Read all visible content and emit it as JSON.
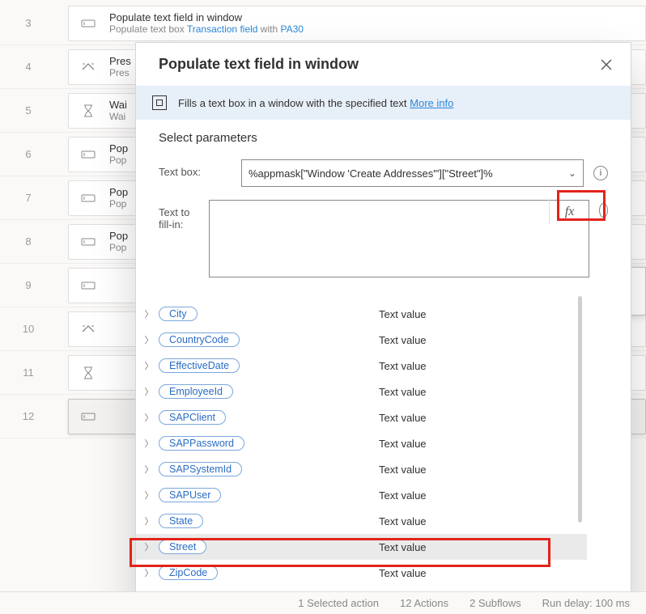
{
  "dialog": {
    "title": "Populate text field in window",
    "info_text": "Fills a text box in a window with the specified text ",
    "more_info": "More info",
    "section_title": "Select parameters",
    "labels": {
      "textbox": "Text box:",
      "fillin": "Text to fill-in:"
    },
    "textbox_value": "%appmask[\"Window 'Create Addresses'\"][\"Street\"]%",
    "fillin_value": ""
  },
  "variables": [
    {
      "name": "City",
      "type": "Text value",
      "selected": false
    },
    {
      "name": "CountryCode",
      "type": "Text value",
      "selected": false
    },
    {
      "name": "EffectiveDate",
      "type": "Text value",
      "selected": false
    },
    {
      "name": "EmployeeId",
      "type": "Text value",
      "selected": false
    },
    {
      "name": "SAPClient",
      "type": "Text value",
      "selected": false
    },
    {
      "name": "SAPPassword",
      "type": "Text value",
      "selected": false
    },
    {
      "name": "SAPSystemId",
      "type": "Text value",
      "selected": false
    },
    {
      "name": "SAPUser",
      "type": "Text value",
      "selected": false
    },
    {
      "name": "State",
      "type": "Text value",
      "selected": false
    },
    {
      "name": "Street",
      "type": "Text value",
      "selected": true
    },
    {
      "name": "ZipCode",
      "type": "Text value",
      "selected": false
    }
  ],
  "steps": [
    {
      "num": "3",
      "icon": "textfield",
      "title": "Populate text field in window",
      "sub_prefix": "Populate text box ",
      "link1": "Transaction field",
      "sub_mid": " with ",
      "link2": "PA30"
    },
    {
      "num": "4",
      "icon": "keyboard",
      "title": "Pres",
      "sub_prefix": "Pres"
    },
    {
      "num": "5",
      "icon": "hourglass",
      "title": "Wai",
      "sub_prefix": "Wai"
    },
    {
      "num": "6",
      "icon": "textfield",
      "title": "Pop",
      "sub_prefix": "Pop"
    },
    {
      "num": "7",
      "icon": "textfield",
      "title": "Pop",
      "sub_prefix": "Pop"
    },
    {
      "num": "8",
      "icon": "textfield",
      "title": "Pop",
      "sub_prefix": "Pop"
    },
    {
      "num": "9",
      "icon": "textfield",
      "title": "",
      "sub_prefix": ""
    },
    {
      "num": "10",
      "icon": "keyboard",
      "title": "",
      "sub_prefix": ""
    },
    {
      "num": "11",
      "icon": "hourglass",
      "title": "",
      "sub_prefix": ""
    },
    {
      "num": "12",
      "icon": "textfield",
      "title": "",
      "sub_prefix": "",
      "selected": true
    }
  ],
  "status": {
    "selected": "1 Selected action",
    "actions": "12 Actions",
    "subflows": "2 Subflows",
    "delay": "Run delay: 100 ms"
  }
}
